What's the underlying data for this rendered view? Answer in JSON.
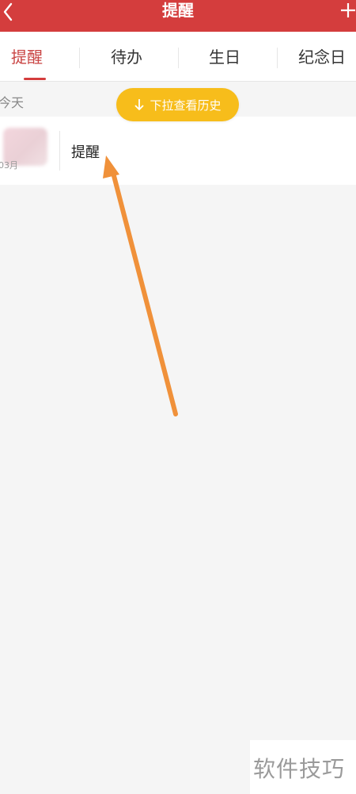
{
  "header": {
    "title": "提醒",
    "back_icon": "chevron-left-icon",
    "add_icon": "plus-icon",
    "background": "#d43d3d"
  },
  "tabs": [
    {
      "label": "提醒",
      "active": true
    },
    {
      "label": "待办",
      "active": false
    },
    {
      "label": "生日",
      "active": false
    },
    {
      "label": "纪念日",
      "active": false
    }
  ],
  "section": {
    "label": "今天"
  },
  "pull_hint": {
    "icon": "arrow-down-icon",
    "label": "下拉查看历史",
    "color": "#f7bd1b"
  },
  "list": {
    "items": [
      {
        "title": "提醒",
        "date": "03月"
      }
    ]
  },
  "annotation": {
    "color": "#f0913a"
  },
  "watermark": {
    "text": "软件技巧"
  }
}
